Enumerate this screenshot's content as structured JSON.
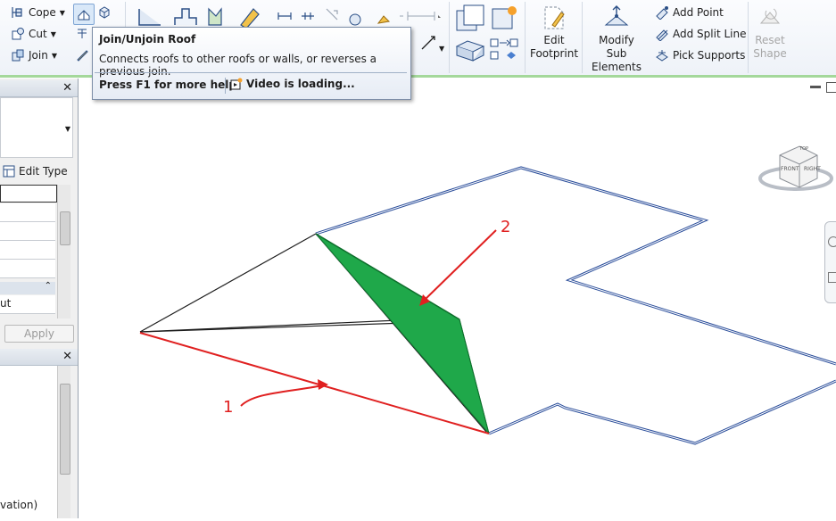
{
  "ribbon": {
    "geometry": {
      "cope": "Cope",
      "cut": "Cut",
      "join": "Join"
    },
    "edit_footprint": {
      "line1": "Edit",
      "line2": "Footprint"
    },
    "modify_sub": {
      "line1": "Modify",
      "line2": "Sub Elements"
    },
    "shape_editing": {
      "add_point": "Add Point",
      "add_split_line": "Add Split Line",
      "pick_supports": "Pick Supports"
    },
    "reset_shape": {
      "line1": "Reset",
      "line2": "Shape"
    }
  },
  "properties_panel": {
    "edit_type": "Edit Type",
    "row_value": "ut",
    "apply": "Apply"
  },
  "browser_panel": {
    "item": "vation)"
  },
  "tooltip": {
    "title": "Join/Unjoin Roof",
    "description": "Connects roofs to other roofs or walls, or reverses a previous join.",
    "help": "Press F1 for more help",
    "video": "Video is loading..."
  },
  "viewcube": {
    "front": "FRONT",
    "right": "RIGHT",
    "top": "TOP"
  },
  "annotations": {
    "label1": "1",
    "label2": "2"
  },
  "colors": {
    "accent": "#a4d89a",
    "footprint": "#2a4d9a",
    "roof_face": "#1fa84a",
    "callout": "#e02020"
  }
}
